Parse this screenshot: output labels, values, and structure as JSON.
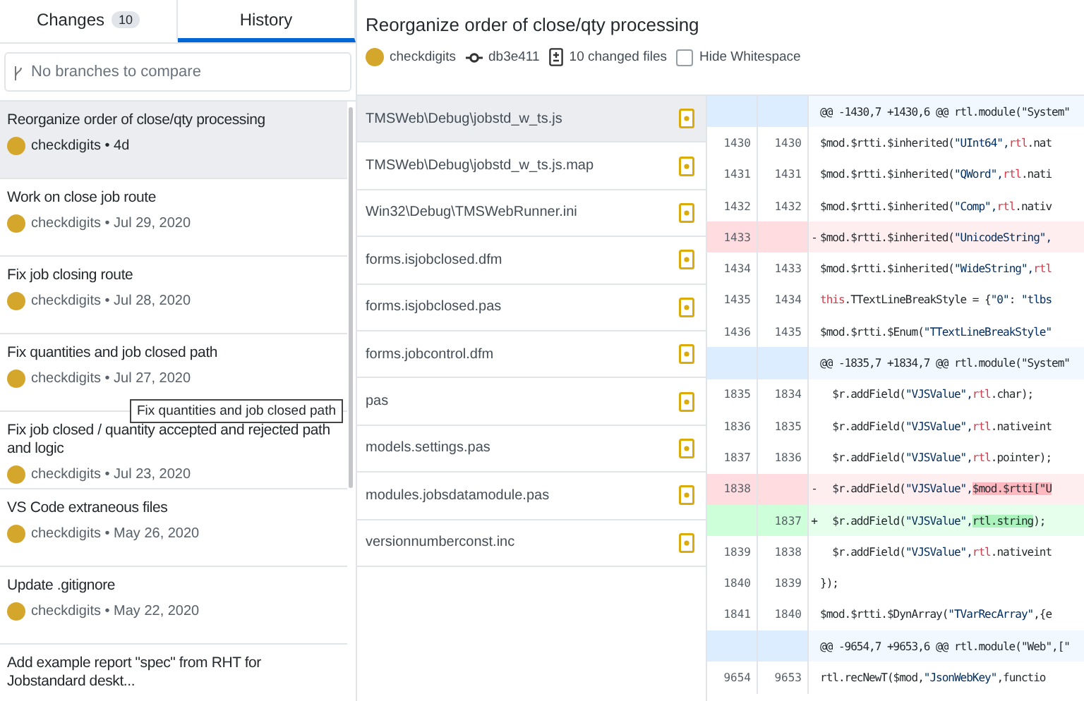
{
  "tabs": [
    {
      "label": "Changes",
      "badge": "10",
      "selected": false
    },
    {
      "label": "History",
      "selected": true
    }
  ],
  "branch_filter": {
    "placeholder": "No branches to compare"
  },
  "commits": [
    {
      "title": "Reorganize order of close/qty processing",
      "author": "checkdigits",
      "separator": "•",
      "date": "4d",
      "selected": true
    },
    {
      "title": "Work on close job route",
      "author": "checkdigits",
      "separator": "•",
      "date": "Jul 29, 2020",
      "selected": false
    },
    {
      "title": "Fix job closing route",
      "author": "checkdigits",
      "separator": "•",
      "date": "Jul 28, 2020",
      "selected": false
    },
    {
      "title": "Fix quantities and job closed path",
      "author": "checkdigits",
      "separator": "•",
      "date": "Jul 27, 2020",
      "selected": false
    },
    {
      "title": "Fix job closed / quantity accepted and rejected path and logic",
      "author": "checkdigits",
      "separator": "•",
      "date": "Jul 23, 2020",
      "selected": false
    },
    {
      "title": "VS Code extraneous files",
      "author": "checkdigits",
      "separator": "•",
      "date": "May 26, 2020",
      "selected": false
    },
    {
      "title": "Update .gitignore",
      "author": "checkdigits",
      "separator": "•",
      "date": "May 22, 2020",
      "selected": false
    },
    {
      "title": "Add example report \"spec\" from RHT for Jobstandard deskt...",
      "selected": false
    }
  ],
  "tooltip": "Fix quantities and job closed path",
  "commit_header": {
    "title": "Reorganize order of close/qty processing",
    "author": "checkdigits",
    "sha": "db3e411",
    "changed_files": "10 changed files",
    "hide_whitespace": {
      "label": "Hide Whitespace",
      "checked": false
    }
  },
  "files": [
    {
      "path": "TMSWeb\\Debug\\jobstd_w_ts.js",
      "kind": "modified",
      "selected": true
    },
    {
      "path": "TMSWeb\\Debug\\jobstd_w_ts.js.map",
      "kind": "modified",
      "selected": false
    },
    {
      "path": "Win32\\Debug\\TMSWebRunner.ini",
      "kind": "modified",
      "selected": false
    },
    {
      "path": "forms.isjobclosed.dfm",
      "kind": "modified",
      "selected": false
    },
    {
      "path": "forms.isjobclosed.pas",
      "kind": "modified",
      "selected": false
    },
    {
      "path": "forms.jobcontrol.dfm",
      "kind": "modified",
      "selected": false
    },
    {
      "path": "pas",
      "kind": "modified",
      "selected": false
    },
    {
      "path": "models.settings.pas",
      "kind": "modified",
      "selected": false
    },
    {
      "path": "modules.jobsdatamodule.pas",
      "kind": "modified",
      "selected": false
    },
    {
      "path": "versionnumberconst.inc",
      "kind": "modified",
      "selected": false
    }
  ],
  "diff": [
    {
      "kind": "hunk",
      "code": [
        {
          "text": "@@ -1430,7 +1430,6 @@ rtl.module(\"System\"",
          "kind": "plain"
        }
      ]
    },
    {
      "kind": "context",
      "old": "1430",
      "new": "1430",
      "code": [
        {
          "text": "$mod.$rtti.$inherited(",
          "kind": "plain"
        },
        {
          "text": "\"UInt64\",",
          "kind": "string"
        },
        {
          "text": "rtl",
          "kind": "keyword"
        },
        {
          "text": ".nat",
          "kind": "plain"
        }
      ]
    },
    {
      "kind": "context",
      "old": "1431",
      "new": "1431",
      "code": [
        {
          "text": "$mod.$rtti.$inherited(",
          "kind": "plain"
        },
        {
          "text": "\"QWord\",",
          "kind": "string"
        },
        {
          "text": "rtl",
          "kind": "keyword"
        },
        {
          "text": ".nati",
          "kind": "plain"
        }
      ]
    },
    {
      "kind": "context",
      "old": "1432",
      "new": "1432",
      "code": [
        {
          "text": "$mod.$rtti.$inherited(",
          "kind": "plain"
        },
        {
          "text": "\"Comp\",",
          "kind": "string"
        },
        {
          "text": "rtl",
          "kind": "keyword"
        },
        {
          "text": ".nativ",
          "kind": "plain"
        }
      ]
    },
    {
      "kind": "deleted",
      "old": "1433",
      "sign": "-",
      "code": [
        {
          "text": "$mod.$rtti.$inherited(",
          "kind": "plain"
        },
        {
          "text": "\"UnicodeString\",",
          "kind": "string"
        }
      ]
    },
    {
      "kind": "context",
      "old": "1434",
      "new": "1433",
      "code": [
        {
          "text": "$mod.$rtti.$inherited(",
          "kind": "plain"
        },
        {
          "text": "\"WideString\",",
          "kind": "string"
        },
        {
          "text": "rtl",
          "kind": "keyword"
        }
      ]
    },
    {
      "kind": "context",
      "old": "1435",
      "new": "1434",
      "code": [
        {
          "text": "this",
          "kind": "keyword"
        },
        {
          "text": ".TTextLineBreakStyle = {",
          "kind": "plain"
        },
        {
          "text": "\"0\"",
          "kind": "string"
        },
        {
          "text": ": ",
          "kind": "plain"
        },
        {
          "text": "\"tlbs",
          "kind": "string"
        }
      ]
    },
    {
      "kind": "context",
      "old": "1436",
      "new": "1435",
      "code": [
        {
          "text": "$mod.$rtti.$Enum(",
          "kind": "plain"
        },
        {
          "text": "\"TTextLineBreakStyle\"",
          "kind": "string"
        }
      ]
    },
    {
      "kind": "hunk",
      "code": [
        {
          "text": "@@ -1835,7 +1834,7 @@ rtl.module(\"System\"",
          "kind": "plain"
        }
      ]
    },
    {
      "kind": "context",
      "old": "1835",
      "new": "1834",
      "code": [
        {
          "text": "  $r.addField(",
          "kind": "plain"
        },
        {
          "text": "\"VJSValue\",",
          "kind": "string"
        },
        {
          "text": "rtl",
          "kind": "keyword"
        },
        {
          "text": ".char);",
          "kind": "plain"
        }
      ]
    },
    {
      "kind": "context",
      "old": "1836",
      "new": "1835",
      "code": [
        {
          "text": "  $r.addField(",
          "kind": "plain"
        },
        {
          "text": "\"VJSValue\",",
          "kind": "string"
        },
        {
          "text": "rtl",
          "kind": "keyword"
        },
        {
          "text": ".nativeint",
          "kind": "plain"
        }
      ]
    },
    {
      "kind": "context",
      "old": "1837",
      "new": "1836",
      "code": [
        {
          "text": "  $r.addField(",
          "kind": "plain"
        },
        {
          "text": "\"VJSValue\",",
          "kind": "string"
        },
        {
          "text": "rtl",
          "kind": "keyword"
        },
        {
          "text": ".pointer);",
          "kind": "plain"
        }
      ]
    },
    {
      "kind": "deleted",
      "old": "1838",
      "sign": "-",
      "code": [
        {
          "text": "  $r.addField(",
          "kind": "plain"
        },
        {
          "text": "\"VJSValue\",",
          "kind": "string"
        },
        {
          "text": "$mod.$rtti[\"U",
          "kind": "changed"
        }
      ]
    },
    {
      "kind": "added",
      "new": "1837",
      "sign": "+",
      "code": [
        {
          "text": "  $r.addField(",
          "kind": "plain"
        },
        {
          "text": "\"VJSValue\",",
          "kind": "string"
        },
        {
          "text": "rtl.string",
          "kind": "changed"
        },
        {
          "text": ");",
          "kind": "plain"
        }
      ]
    },
    {
      "kind": "context",
      "old": "1839",
      "new": "1838",
      "code": [
        {
          "text": "  $r.addField(",
          "kind": "plain"
        },
        {
          "text": "\"VJSValue\",",
          "kind": "string"
        },
        {
          "text": "rtl",
          "kind": "keyword"
        },
        {
          "text": ".nativeint",
          "kind": "plain"
        }
      ]
    },
    {
      "kind": "context",
      "old": "1840",
      "new": "1839",
      "code": [
        {
          "text": "});",
          "kind": "plain"
        }
      ]
    },
    {
      "kind": "context",
      "old": "1841",
      "new": "1840",
      "code": [
        {
          "text": "$mod.$rtti.$DynArray(",
          "kind": "plain"
        },
        {
          "text": "\"TVarRecArray\"",
          "kind": "string"
        },
        {
          "text": ",{e",
          "kind": "plain"
        }
      ]
    },
    {
      "kind": "hunk",
      "code": [
        {
          "text": "@@ -9654,7 +9653,6 @@ rtl.module(\"Web\",[\"",
          "kind": "plain"
        }
      ]
    },
    {
      "kind": "context",
      "old": "9654",
      "new": "9653",
      "code": [
        {
          "text": "rtl.recNewT($mod,",
          "kind": "plain"
        },
        {
          "text": "\"JsonWebKey\"",
          "kind": "string"
        },
        {
          "text": ",functio",
          "kind": "plain"
        }
      ]
    }
  ]
}
